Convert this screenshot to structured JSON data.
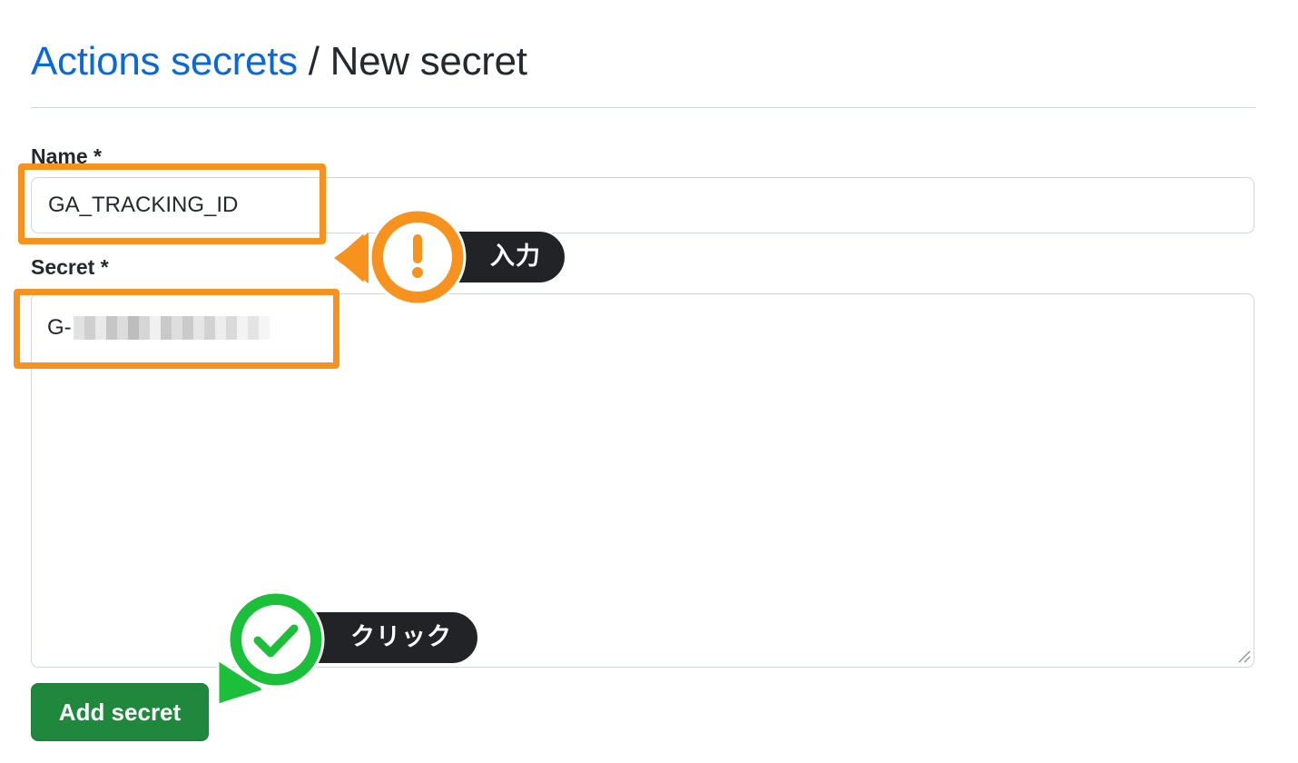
{
  "header": {
    "breadcrumb_link": "Actions secrets",
    "separator": "/",
    "current": "New secret"
  },
  "form": {
    "name_label": "Name *",
    "name_value": "GA_TRACKING_ID",
    "secret_label": "Secret *",
    "secret_value_visible": "G-",
    "submit_label": "Add secret"
  },
  "annotations": {
    "input_callout": "入力",
    "click_callout": "クリック",
    "input_icon": "exclamation-icon",
    "click_icon": "checkmark-icon",
    "highlight_color": "#f7921e",
    "input_badge_color": "#f7921e",
    "click_badge_color": "#1bbf3a"
  },
  "colors": {
    "link": "#0969da",
    "primary_button": "#1f883d",
    "callout_pill": "#222326"
  }
}
